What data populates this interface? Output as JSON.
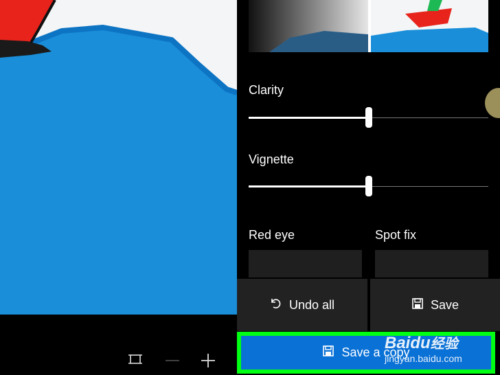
{
  "panel": {
    "clarity_label": "Clarity",
    "clarity_value": 0.5,
    "vignette_label": "Vignette",
    "vignette_value": 0.5,
    "red_eye_label": "Red eye",
    "spot_fix_label": "Spot fix",
    "undo_label": "Undo all",
    "save_label": "Save",
    "save_copy_label": "Save a copy"
  },
  "icons": {
    "undo": "undo-icon",
    "save": "floppy-icon",
    "fit": "fit-screen-icon",
    "zoom_out": "minus-icon",
    "zoom_in": "plus-icon"
  },
  "watermark": {
    "brand": "Baidu",
    "brand_suffix": "经验",
    "url": "jingyan.baidu.com"
  },
  "colors": {
    "accent": "#0a71d6",
    "highlight": "#00ff12",
    "water": "#1a8ed9"
  }
}
